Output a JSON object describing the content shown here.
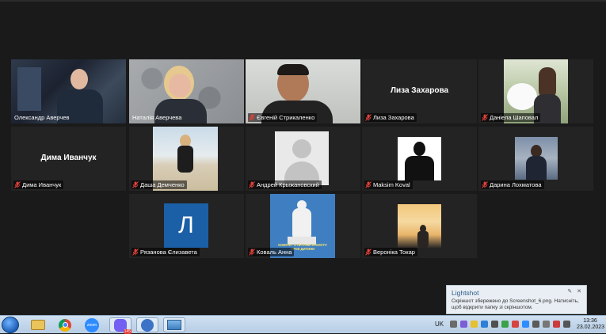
{
  "app": {
    "window": "Zoom Meeting"
  },
  "participants": [
    {
      "name": "Олександр Аверчев",
      "type": "video",
      "active": true,
      "muted": false
    },
    {
      "name": "Наталія Аверчева",
      "type": "video",
      "muted": false
    },
    {
      "name": "Євгеній Стрикаленко",
      "type": "video",
      "muted": true
    },
    {
      "name": "Лиза Захарова",
      "type": "name-only",
      "muted": true,
      "display_name": "Лиза Захарова"
    },
    {
      "name": "Даніела Шаповал",
      "type": "photo",
      "muted": true
    },
    {
      "name": "Дима Иванчук",
      "type": "name-only",
      "muted": true,
      "display_name": "Дима Иванчук"
    },
    {
      "name": "Даша Демченко",
      "type": "photo",
      "muted": true
    },
    {
      "name": "Андрей Крыжановский",
      "type": "avatar",
      "muted": true
    },
    {
      "name": "Maksim Koval",
      "type": "photo",
      "muted": true
    },
    {
      "name": "Дарина Лохматова",
      "type": "photo",
      "muted": true
    },
    {
      "name": "Рязанова Єлизавета",
      "type": "letter",
      "letter": "Л",
      "muted": true
    },
    {
      "name": "Коваль Анна",
      "type": "photo",
      "muted": true,
      "photo_caption": "КОМІТЕТ З ПИТАНЬ ЗАХИСТУ ПРАВ ДИТИНИ"
    },
    {
      "name": "Вероніка Токар",
      "type": "photo",
      "muted": true
    }
  ],
  "notification": {
    "title": "Lightshot",
    "text": "Скріншот збережено до Screenshot_6.png. Натисніть, щоб відкрити папку зі скріншотом.",
    "icons": [
      "pin-icon",
      "close-icon"
    ]
  },
  "taskbar": {
    "apps": [
      "start-orb",
      "explorer",
      "chrome",
      "zoom",
      "viber",
      "teams",
      "photos"
    ],
    "viber_badge": "145",
    "language": "UK",
    "time": "13:36",
    "date": "23.02.2023"
  },
  "colors": {
    "active_speaker": "#c9dd53",
    "muted_mic": "#e0403a",
    "zoom_blue": "#2d8cff"
  }
}
